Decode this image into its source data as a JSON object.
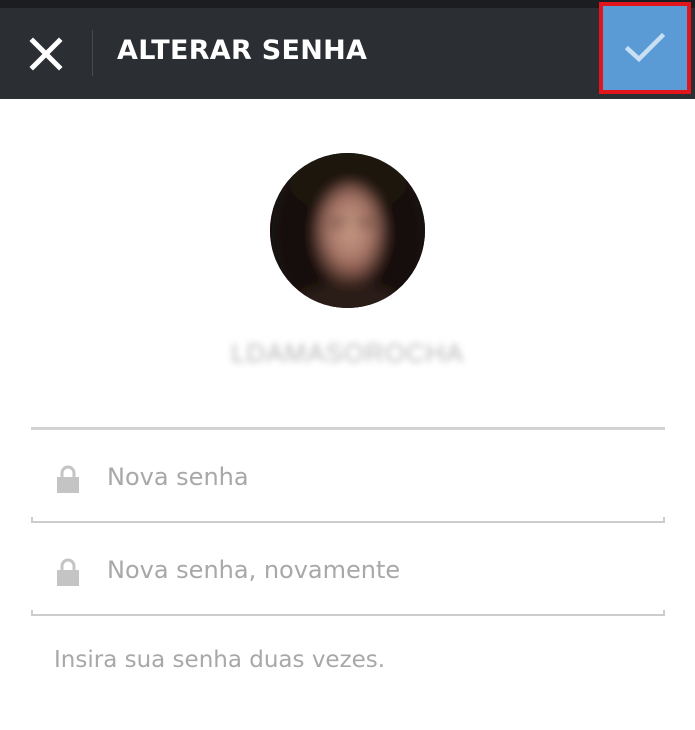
{
  "header": {
    "title": "ALTERAR SENHA",
    "close_icon": "close-icon",
    "confirm_icon": "checkmark-icon",
    "confirm_color": "#5a9bd5",
    "highlight_color": "#e3151c"
  },
  "profile": {
    "username": "LDAMASOROCHA"
  },
  "form": {
    "new_password": {
      "placeholder": "Nova senha",
      "value": "",
      "icon": "lock-icon"
    },
    "confirm_password": {
      "placeholder": "Nova senha, novamente",
      "value": "",
      "icon": "lock-icon"
    },
    "hint": "Insira sua senha duas vezes."
  }
}
